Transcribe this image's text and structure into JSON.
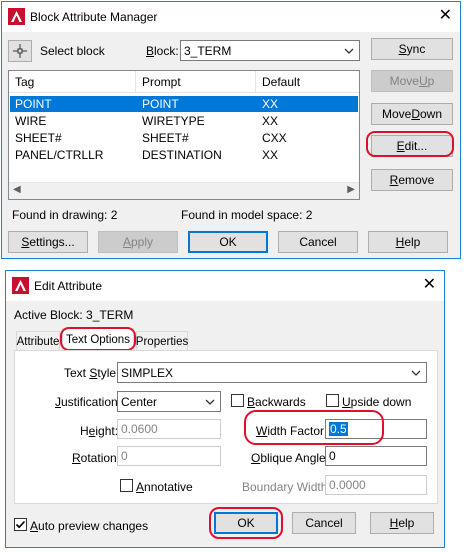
{
  "bam": {
    "title": "Block Attribute Manager",
    "select_block_label": "Select block",
    "block_label": "Block:",
    "block_value": "3_TERM",
    "columns": [
      "Tag",
      "Prompt",
      "Default"
    ],
    "rows": [
      {
        "tag": "POINT",
        "prompt": "POINT",
        "default": "XX"
      },
      {
        "tag": "WIRE",
        "prompt": "WIRETYPE",
        "default": "XX"
      },
      {
        "tag": "SHEET#",
        "prompt": "SHEET#",
        "default": "CXX"
      },
      {
        "tag": "PANEL/CTRLLR",
        "prompt": "DESTINATION",
        "default": "XX"
      }
    ],
    "buttons": {
      "sync": "Sync",
      "move_up": "Move Up",
      "move_down": "Move Down",
      "edit": "Edit...",
      "remove": "Remove",
      "settings": "Settings...",
      "apply": "Apply",
      "ok": "OK",
      "cancel": "Cancel",
      "help": "Help"
    },
    "found_in_drawing": "Found in drawing: 2",
    "found_in_model_space": "Found in model space: 2"
  },
  "ea": {
    "title": "Edit Attribute",
    "active_block": "Active Block: 3_TERM",
    "tabs": [
      "Attribute",
      "Text Options",
      "Properties"
    ],
    "text_style_label": "Text Style:",
    "text_style_value": "SIMPLEX",
    "justification_label": "Justification:",
    "justification_value": "Center",
    "backwards_label": "Backwards",
    "upside_down_label": "Upside down",
    "height_label": "Height:",
    "height_value": "0.0600",
    "width_factor_label": "Width Factor:",
    "width_factor_value": "0.5",
    "rotation_label": "Rotation:",
    "rotation_value": "0",
    "oblique_angle_label": "Oblique Angle:",
    "oblique_angle_value": "0",
    "annotative_label": "Annotative",
    "boundary_width_label": "Boundary Width:",
    "boundary_width_value": "0.0000",
    "auto_preview_label": "Auto preview changes",
    "buttons": {
      "ok": "OK",
      "cancel": "Cancel",
      "help": "Help"
    }
  },
  "colors": {
    "accent": "#0078d7",
    "highlight_ring": "#e0102b",
    "app_icon": "#c8102e"
  }
}
